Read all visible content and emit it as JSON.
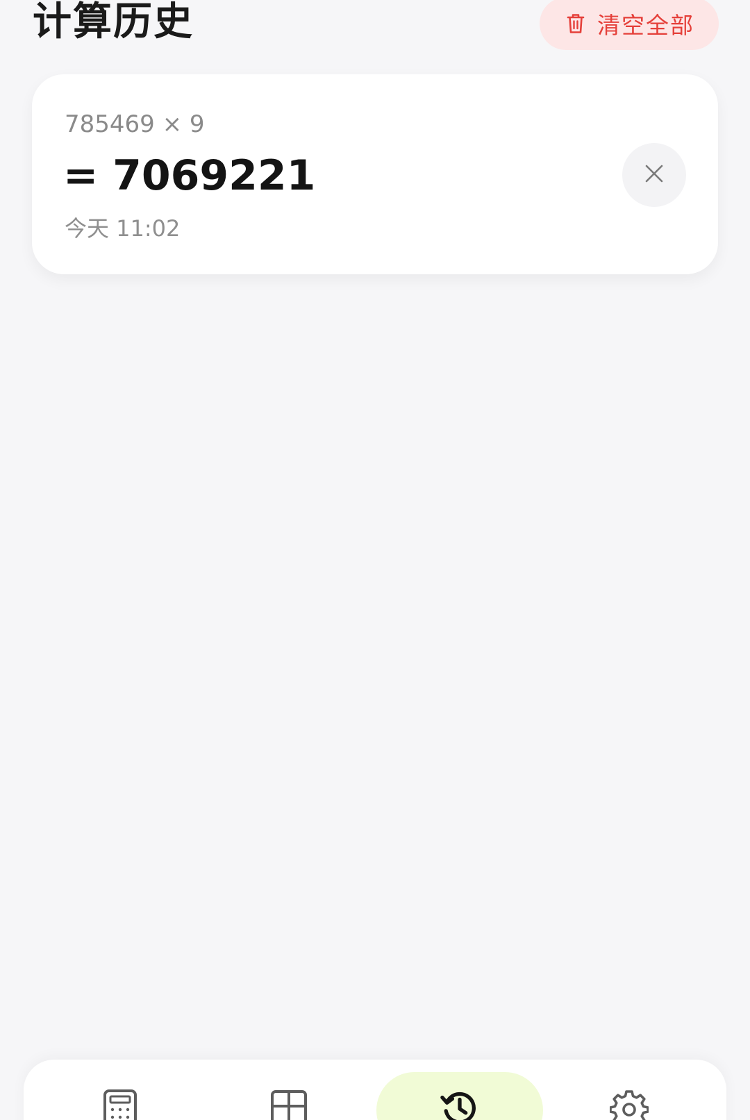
{
  "header": {
    "title": "计算历史",
    "clear_all_label": "清空全部"
  },
  "history": [
    {
      "expression": "785469 × 9",
      "result": "= 7069221",
      "time": "今天 11:02"
    }
  ],
  "nav": {
    "items": [
      {
        "name": "calculator",
        "icon": "calculator-icon"
      },
      {
        "name": "grid",
        "icon": "grid-icon"
      },
      {
        "name": "history",
        "icon": "history-icon",
        "active": true
      },
      {
        "name": "settings",
        "icon": "gear-icon"
      }
    ]
  },
  "colors": {
    "background": "#f6f6f8",
    "clear_bg": "#fde6e6",
    "clear_text": "#e5403a",
    "active_pill": "#f1fbd6",
    "text_primary": "#141414",
    "text_secondary": "#8a8a8a"
  }
}
